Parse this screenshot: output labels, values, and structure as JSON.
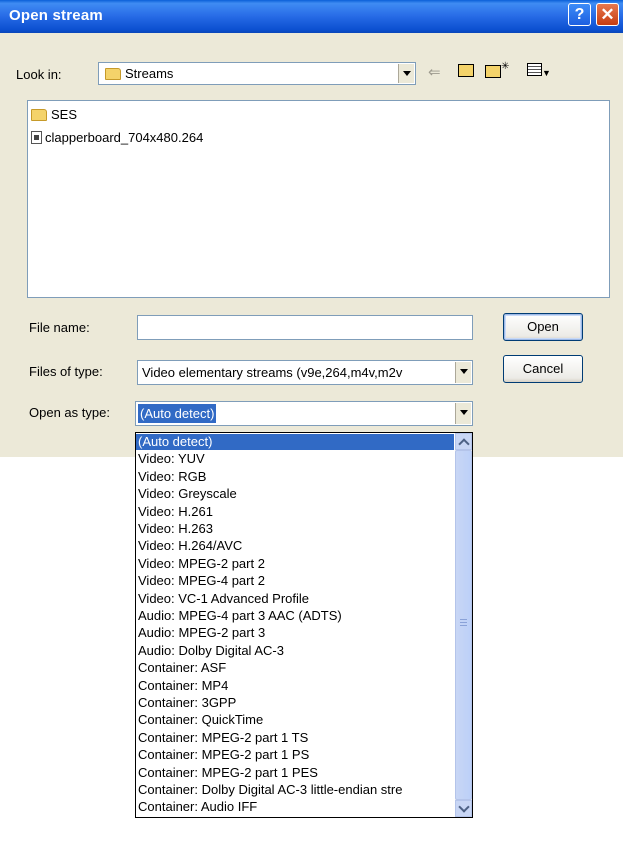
{
  "dialog": {
    "title": "Open stream",
    "help_label": "?",
    "close_label": "✕"
  },
  "look_in": {
    "label": "Look in:",
    "value": "Streams"
  },
  "files": [
    {
      "name": "SES",
      "type": "folder"
    },
    {
      "name": "clapperboard_704x480.264",
      "type": "file"
    }
  ],
  "file_name": {
    "label": "File name:",
    "value": ""
  },
  "files_of_type": {
    "label": "Files of type:",
    "value": "Video elementary streams (v9e,264,m4v,m2v"
  },
  "open_as_type": {
    "label": "Open as type:",
    "value": "(Auto detect)",
    "options": [
      "(Auto detect)",
      "Video: YUV",
      "Video: RGB",
      "Video: Greyscale",
      "Video: H.261",
      "Video: H.263",
      "Video: H.264/AVC",
      "Video: MPEG-2 part 2",
      "Video: MPEG-4 part 2",
      "Video: VC-1 Advanced Profile",
      "Audio: MPEG-4 part 3 AAC (ADTS)",
      "Audio: MPEG-2 part 3",
      "Audio: Dolby Digital AC-3",
      "Container: ASF",
      "Container: MP4",
      "Container: 3GPP",
      "Container: QuickTime",
      "Container: MPEG-2 part 1 TS",
      "Container: MPEG-2 part 1 PS",
      "Container: MPEG-2 part 1 PES",
      "Container: Dolby Digital AC-3 little-endian stre",
      "Container: Audio IFF"
    ],
    "selected_index": 0
  },
  "buttons": {
    "open": "Open",
    "cancel": "Cancel"
  },
  "colors": {
    "title_bar": "#0a5fd8",
    "dialog_bg": "#ece9d8",
    "selection": "#316ac5"
  }
}
